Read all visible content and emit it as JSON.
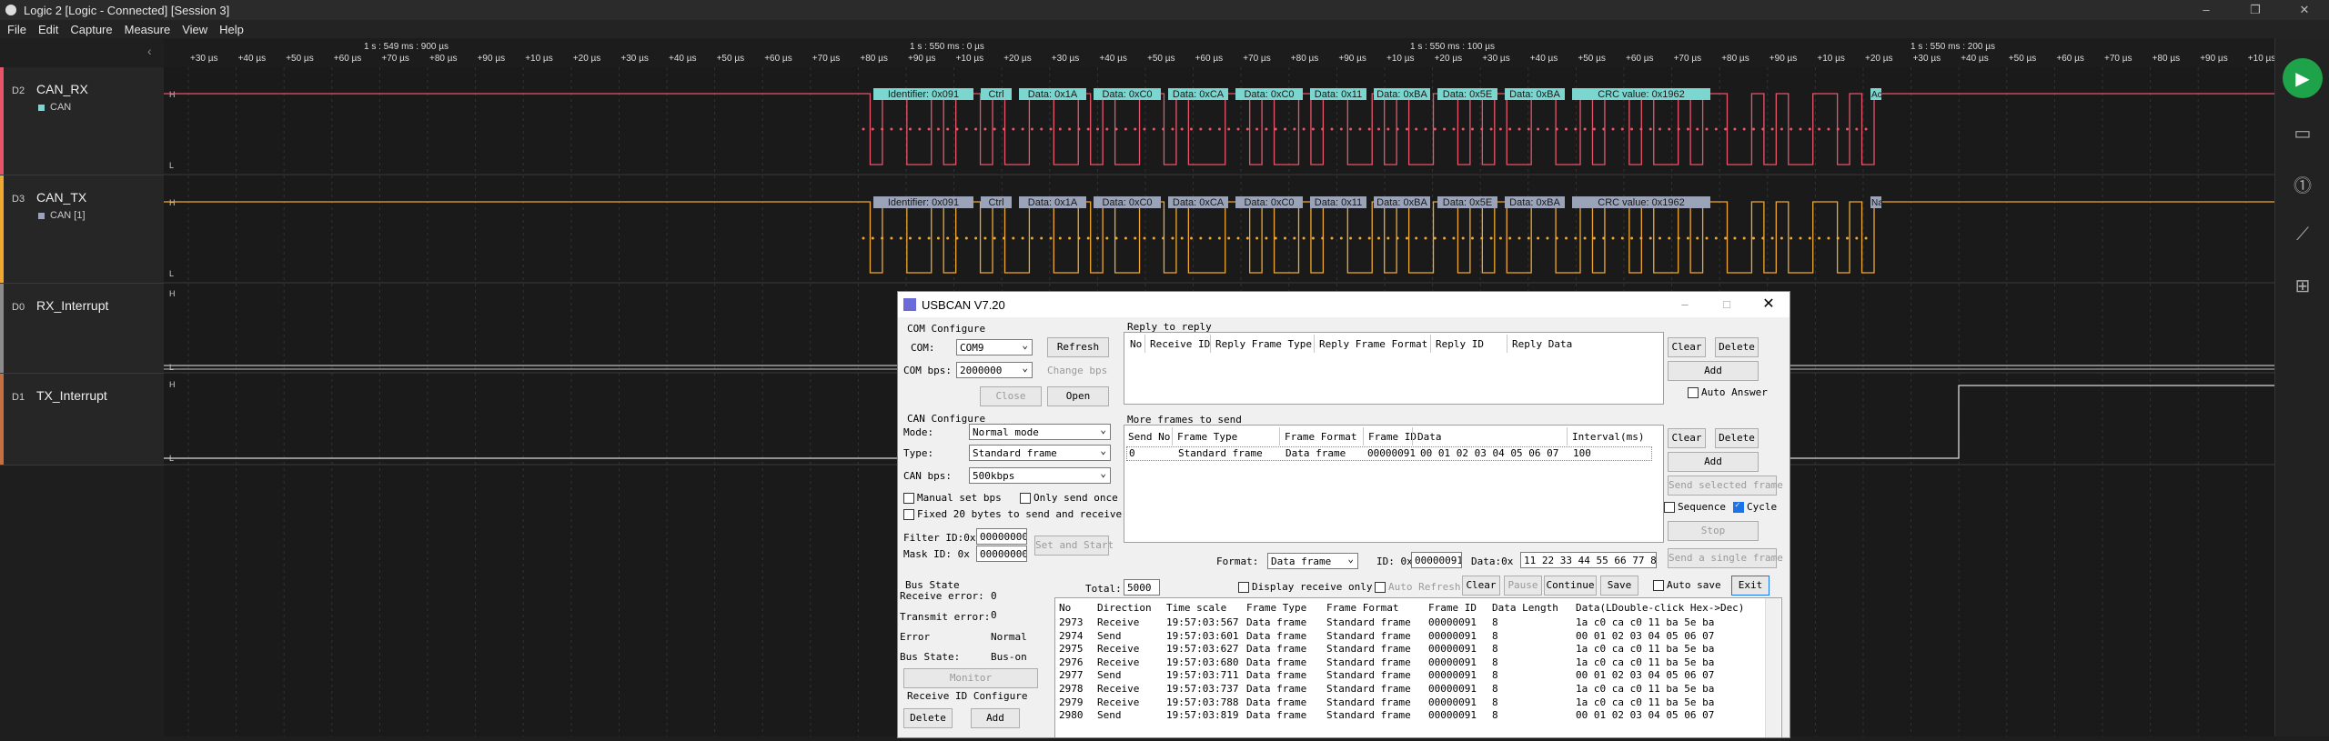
{
  "window": {
    "title": "Logic 2 [Logic - Connected] [Session 3]"
  },
  "menu": [
    "File",
    "Edit",
    "Capture",
    "Measure",
    "View",
    "Help"
  ],
  "timeline": {
    "section_labels": [
      "1 s : 549 ms : 900 µs",
      "1 s : 550 ms : 0 µs",
      "1 s : 550 ms : 100 µs",
      "1 s : 550 ms : 200 µs"
    ],
    "ticks": [
      "+30 µs",
      "+40 µs",
      "+50 µs",
      "+60 µs",
      "+70 µs",
      "+80 µs",
      "+90 µs",
      "+10 µs",
      "+20 µs",
      "+30 µs",
      "+40 µs",
      "+50 µs",
      "+60 µs",
      "+70 µs",
      "+80 µs",
      "+90 µs",
      "+10 µs",
      "+20 µs",
      "+30 µs",
      "+40 µs",
      "+50 µs",
      "+60 µs",
      "+70 µs",
      "+80 µs",
      "+90 µs",
      "+10 µs",
      "+20 µs",
      "+30 µs",
      "+40 µs",
      "+50 µs",
      "+60 µs",
      "+70 µs",
      "+80 µs",
      "+90 µs",
      "+10 µs",
      "+20 µs",
      "+30 µs",
      "+40 µs",
      "+50 µs",
      "+60 µs",
      "+70 µs",
      "+80 µs",
      "+90 µs",
      "+10 µs",
      "+20 µs",
      "+30 µs",
      "+40 µs",
      "+50 µs"
    ]
  },
  "channels": [
    {
      "id": "D2",
      "name": "CAN_RX",
      "analyzer": "CAN",
      "color": "#e8556a",
      "analyzer_color": "#7ad6cf"
    },
    {
      "id": "D3",
      "name": "CAN_TX",
      "analyzer": "CAN [1]",
      "color": "#f0a830",
      "analyzer_color": "#9aa3b8"
    },
    {
      "id": "D0",
      "name": "RX_Interrupt",
      "analyzer": "",
      "color": "#8c8c8c",
      "analyzer_color": ""
    },
    {
      "id": "D1",
      "name": "TX_Interrupt",
      "analyzer": "",
      "color": "#c67042",
      "analyzer_color": ""
    }
  ],
  "protocol_frames": [
    "Identifier: 0x091",
    "Ctrl",
    "Data: 0x1A",
    "Data: 0xC0",
    "Data: 0xCA",
    "Data: 0xC0",
    "Data: 0x11",
    "Data: 0xBA",
    "Data: 0x5E",
    "Data: 0xBA",
    "CRC value: 0x1962"
  ],
  "frame_tail": {
    "rx": "Ac",
    "tx": "Na"
  },
  "level_labels": {
    "high": "H",
    "low": "L"
  },
  "usbcan": {
    "title": "USBCAN V7.20",
    "com_config": {
      "group": "COM Configure",
      "com_label": "COM:",
      "com_value": "COM9",
      "refresh": "Refresh",
      "bps_label": "COM bps:",
      "bps_value": "2000000",
      "change_bps": "Change bps",
      "close": "Close",
      "open": "Open"
    },
    "can_config": {
      "group": "CAN Configure",
      "mode_label": "Mode:",
      "mode_value": "Normal mode",
      "type_label": "Type:",
      "type_value": "Standard frame",
      "bps_label": "CAN bps:",
      "bps_value": "500kbps",
      "manual_bps": "Manual set bps",
      "only_once": "Only send once",
      "fixed20": "Fixed 20 bytes to send and receive",
      "filter_label": "Filter ID:0x",
      "filter_value": "00000000",
      "mask_label": "Mask ID:  0x",
      "mask_value": "00000000",
      "set_start": "Set and Start"
    },
    "bus_state": {
      "group": "Bus State",
      "rx_err_label": "Receive error:",
      "rx_err": "0",
      "tx_err_label": "Transmit error:",
      "tx_err": "0",
      "error_label": "Error",
      "error": "Normal",
      "bus_label": "Bus State:",
      "bus": "Bus-on",
      "monitor": "Monitor"
    },
    "recv_id": {
      "group": "Receive ID Configure",
      "delete": "Delete",
      "add": "Add"
    },
    "reply": {
      "group": "Reply to reply",
      "columns": [
        "No",
        "Receive ID",
        "Reply Frame Type",
        "Reply Frame Format",
        "Reply  ID",
        "Reply Data"
      ],
      "clear": "Clear",
      "delete": "Delete",
      "add": "Add",
      "auto_answer": "Auto Answer"
    },
    "more": {
      "group": "More frames to send",
      "columns": [
        "Send No",
        "Frame Type",
        "Frame Format",
        "Frame ID",
        "Data",
        "Interval(ms)"
      ],
      "row": [
        "0",
        "Standard frame",
        "Data frame",
        "00000091",
        "00 01 02 03 04 05 06 07",
        "100"
      ],
      "clear": "Clear",
      "delete": "Delete",
      "add": "Add",
      "send_selected": "Send selected frame",
      "sequence": "Sequence",
      "cycle": "Cycle",
      "stop": "Stop"
    },
    "send": {
      "format_label": "Format:",
      "format_value": "Data frame",
      "id_label": "ID: 0x",
      "id_value": "00000091",
      "data_label": "Data:0x",
      "data_value": "11 22 33 44 55 66 77 88",
      "send_single": "Send a single frame"
    },
    "log_ctrl": {
      "total_label": "Total:",
      "total": "5000",
      "display_recv": "Display receive only",
      "auto_refresh": "Auto Refresh",
      "clear": "Clear",
      "pause": "Pause",
      "continue": "Continue",
      "save": "Save",
      "auto_save": "Auto save",
      "exit": "Exit"
    },
    "log": {
      "columns": [
        "No",
        "Direction",
        "Time scale",
        "Frame Type",
        "Frame Format",
        "Frame ID",
        "Data Length",
        "Data(LDouble-click Hex->Dec)"
      ],
      "rows": [
        [
          "2973",
          "Receive",
          "19:57:03:567",
          "Data frame",
          "Standard frame",
          "00000091",
          "8",
          "1a c0 ca c0 11 ba 5e ba"
        ],
        [
          "2974",
          "Send",
          "19:57:03:601",
          "Data frame",
          "Standard frame",
          "00000091",
          "8",
          "00 01 02 03 04 05 06 07"
        ],
        [
          "2975",
          "Receive",
          "19:57:03:627",
          "Data frame",
          "Standard frame",
          "00000091",
          "8",
          "1a c0 ca c0 11 ba 5e ba"
        ],
        [
          "2976",
          "Receive",
          "19:57:03:680",
          "Data frame",
          "Standard frame",
          "00000091",
          "8",
          "1a c0 ca c0 11 ba 5e ba"
        ],
        [
          "2977",
          "Send",
          "19:57:03:711",
          "Data frame",
          "Standard frame",
          "00000091",
          "8",
          "00 01 02 03 04 05 06 07"
        ],
        [
          "2978",
          "Receive",
          "19:57:03:737",
          "Data frame",
          "Standard frame",
          "00000091",
          "8",
          "1a c0 ca c0 11 ba 5e ba"
        ],
        [
          "2979",
          "Receive",
          "19:57:03:788",
          "Data frame",
          "Standard frame",
          "00000091",
          "8",
          "1a c0 ca c0 11 ba 5e ba"
        ],
        [
          "2980",
          "Send",
          "19:57:03:819",
          "Data frame",
          "Standard frame",
          "00000091",
          "8",
          "00 01 02 03 04 05 06 07"
        ]
      ]
    }
  }
}
